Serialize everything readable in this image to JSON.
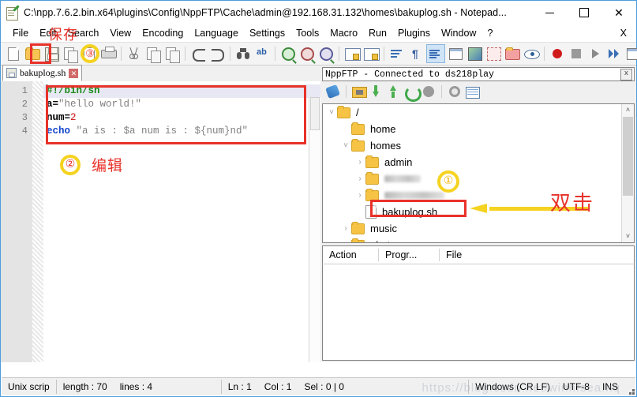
{
  "window": {
    "title": "C:\\npp.7.6.2.bin.x64\\plugins\\Config\\NppFTP\\Cache\\admin@192.168.31.132\\homes\\bakuplog.sh - Notepad...",
    "icon": "notepad-plus-plus-icon",
    "minimize_label": "—",
    "maximize_label": "□",
    "close_label": "✕"
  },
  "menubar": {
    "items": [
      {
        "label": "File"
      },
      {
        "label": "Edit"
      },
      {
        "label": "Search"
      },
      {
        "label": "View"
      },
      {
        "label": "Encoding"
      },
      {
        "label": "Language"
      },
      {
        "label": "Settings"
      },
      {
        "label": "Tools"
      },
      {
        "label": "Macro"
      },
      {
        "label": "Run"
      },
      {
        "label": "Plugins"
      },
      {
        "label": "Window"
      },
      {
        "label": "?"
      }
    ],
    "close_doc_label": "X"
  },
  "toolbar": {
    "overflow_label": "»",
    "icons": [
      "new-file-icon",
      "open-file-icon",
      "save-icon",
      "save-all-icon",
      "close-file-icon",
      "print-icon",
      "cut-icon",
      "copy-icon",
      "paste-icon",
      "undo-icon",
      "redo-icon",
      "find-icon",
      "replace-icon",
      "zoom-in-icon",
      "zoom-out-icon",
      "sync-vertical-icon",
      "sync-horizontal-icon",
      "word-wrap-icon",
      "show-all-chars-icon",
      "indent-guide-icon",
      "ui-user-defined-dialog-icon",
      "document-map-icon",
      "function-list-icon",
      "folder-as-workspace-icon",
      "monitoring-icon",
      "record-macro-icon",
      "stop-record-icon",
      "play-macro-icon",
      "playback-multiple-icon",
      "save-macro-icon"
    ]
  },
  "annotations": {
    "save_text": "保存",
    "step_three": "③",
    "step_two": "②",
    "edit_text": "编辑",
    "step_one": "①",
    "double_click_text": "双击"
  },
  "editor": {
    "tab": {
      "label": "bakuplog.sh",
      "icon": "saved-file-icon",
      "close_label": "✕"
    },
    "line_numbers": [
      "1",
      "2",
      "3",
      "4"
    ],
    "code": [
      {
        "n": 1,
        "tokens": [
          {
            "t": "#!/bin/sh",
            "c": "c-comment"
          }
        ]
      },
      {
        "n": 2,
        "tokens": [
          {
            "t": "a=",
            "c": "c-var"
          },
          {
            "t": "\"hello world!\"",
            "c": "c-str"
          }
        ]
      },
      {
        "n": 3,
        "tokens": [
          {
            "t": "num=",
            "c": "c-var"
          },
          {
            "t": "2",
            "c": "c-num"
          }
        ]
      },
      {
        "n": 4,
        "tokens": [
          {
            "t": "echo",
            "c": "c-kw"
          },
          {
            "t": " \"a is : $a num is : ${num}nd\"",
            "c": "c-str"
          }
        ]
      }
    ]
  },
  "ftp": {
    "panel_title": "NppFTP - Connected to ds218play",
    "close_label": "x",
    "toolbar_icons": [
      "connect-icon",
      "open-dir-icon",
      "download-icon",
      "upload-icon",
      "refresh-icon",
      "abort-icon",
      "settings-gear-icon",
      "messages-grid-icon"
    ],
    "tree": [
      {
        "label": "/",
        "type": "folder",
        "depth": 0,
        "twisty": "˅",
        "blurred": false,
        "selected": false
      },
      {
        "label": "home",
        "type": "folder",
        "depth": 1,
        "twisty": "",
        "blurred": false,
        "selected": false
      },
      {
        "label": "homes",
        "type": "folder",
        "depth": 1,
        "twisty": "˅",
        "blurred": false,
        "selected": false
      },
      {
        "label": "admin",
        "type": "folder",
        "depth": 2,
        "twisty": "›",
        "blurred": false,
        "selected": false
      },
      {
        "label": "",
        "type": "folder",
        "depth": 2,
        "twisty": "›",
        "blurred": true,
        "selected": false
      },
      {
        "label": "",
        "type": "folder",
        "depth": 2,
        "twisty": "›",
        "blurred": true,
        "selected": false
      },
      {
        "label": "bakuplog.sh",
        "type": "file",
        "depth": 2,
        "twisty": "",
        "blurred": false,
        "selected": true
      },
      {
        "label": "music",
        "type": "folder",
        "depth": 1,
        "twisty": "›",
        "blurred": false,
        "selected": false
      },
      {
        "label": "photo",
        "type": "folder",
        "depth": 1,
        "twisty": "›",
        "blurred": false,
        "selected": false
      }
    ],
    "scroll_up": "˄",
    "scroll_down": "˅",
    "queue_columns": [
      "Action",
      "Progr...",
      "File"
    ]
  },
  "statusbar": {
    "language": "Unix scrip",
    "length": "length : 70",
    "lines": "lines : 4",
    "ln": "Ln : 1",
    "col": "Col : 1",
    "sel": "Sel : 0 | 0",
    "eol": "Windows (CR LF)",
    "encoding": "UTF-8",
    "mode": "INS",
    "watermark": "https://blog.csdn.net/winnfsea.nq"
  },
  "colors": {
    "accent_red": "#e8322a",
    "accent_yellow": "#f5d320",
    "selection_blue": "#e8e8f4",
    "comment_green": "#1a8a1a",
    "keyword_blue": "#1144cc",
    "number_red": "#cc1111",
    "string_gray": "#808080",
    "folder_yellow": "#f6c344"
  }
}
